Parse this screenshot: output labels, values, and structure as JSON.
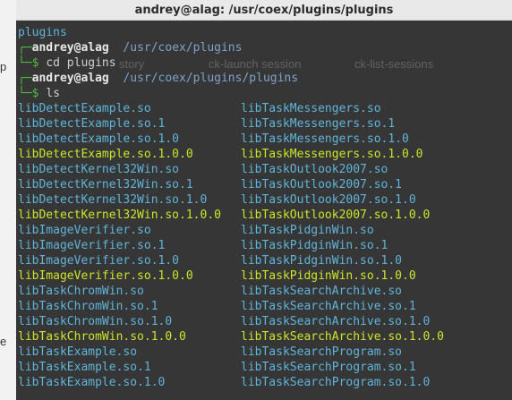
{
  "window": {
    "title": "andrey@alag: /usr/coex/plugins/plugins"
  },
  "background_hints": {
    "left_chars": [
      "p",
      "e"
    ],
    "faint_labels": [
      "ck-launch session",
      "ck-list-sessions",
      "story"
    ]
  },
  "header_line": "plugins",
  "prompts": [
    {
      "user": "andrey@alag",
      "path": "/usr/coex/plugins",
      "command": "cd plugins"
    },
    {
      "user": "andrey@alag",
      "path": "/usr/coex/plugins/plugins",
      "command": "ls"
    }
  ],
  "listing": {
    "left": [
      {
        "name": "libDetectExample.so",
        "kind": "link"
      },
      {
        "name": "libDetectExample.so.1",
        "kind": "link"
      },
      {
        "name": "libDetectExample.so.1.0",
        "kind": "link"
      },
      {
        "name": "libDetectExample.so.1.0.0",
        "kind": "file"
      },
      {
        "name": "libDetectKernel32Win.so",
        "kind": "link"
      },
      {
        "name": "libDetectKernel32Win.so.1",
        "kind": "link"
      },
      {
        "name": "libDetectKernel32Win.so.1.0",
        "kind": "link"
      },
      {
        "name": "libDetectKernel32Win.so.1.0.0",
        "kind": "file"
      },
      {
        "name": "libImageVerifier.so",
        "kind": "link"
      },
      {
        "name": "libImageVerifier.so.1",
        "kind": "link"
      },
      {
        "name": "libImageVerifier.so.1.0",
        "kind": "link"
      },
      {
        "name": "libImageVerifier.so.1.0.0",
        "kind": "file"
      },
      {
        "name": "libTaskChromWin.so",
        "kind": "link"
      },
      {
        "name": "libTaskChromWin.so.1",
        "kind": "link"
      },
      {
        "name": "libTaskChromWin.so.1.0",
        "kind": "link"
      },
      {
        "name": "libTaskChromWin.so.1.0.0",
        "kind": "file"
      },
      {
        "name": "libTaskExample.so",
        "kind": "link"
      },
      {
        "name": "libTaskExample.so.1",
        "kind": "link"
      },
      {
        "name": "libTaskExample.so.1.0",
        "kind": "link"
      }
    ],
    "right": [
      {
        "name": "libTaskMessengers.so",
        "kind": "link"
      },
      {
        "name": "libTaskMessengers.so.1",
        "kind": "link"
      },
      {
        "name": "libTaskMessengers.so.1.0",
        "kind": "link"
      },
      {
        "name": "libTaskMessengers.so.1.0.0",
        "kind": "file"
      },
      {
        "name": "libTaskOutlook2007.so",
        "kind": "link"
      },
      {
        "name": "libTaskOutlook2007.so.1",
        "kind": "link"
      },
      {
        "name": "libTaskOutlook2007.so.1.0",
        "kind": "link"
      },
      {
        "name": "libTaskOutlook2007.so.1.0.0",
        "kind": "file"
      },
      {
        "name": "libTaskPidginWin.so",
        "kind": "link"
      },
      {
        "name": "libTaskPidginWin.so.1",
        "kind": "link"
      },
      {
        "name": "libTaskPidginWin.so.1.0",
        "kind": "link"
      },
      {
        "name": "libTaskPidginWin.so.1.0.0",
        "kind": "file"
      },
      {
        "name": "libTaskSearchArchive.so",
        "kind": "link"
      },
      {
        "name": "libTaskSearchArchive.so.1",
        "kind": "link"
      },
      {
        "name": "libTaskSearchArchive.so.1.0",
        "kind": "link"
      },
      {
        "name": "libTaskSearchArchive.so.1.0.0",
        "kind": "file"
      },
      {
        "name": "libTaskSearchProgram.so",
        "kind": "link"
      },
      {
        "name": "libTaskSearchProgram.so.1",
        "kind": "link"
      },
      {
        "name": "libTaskSearchProgram.so.1.0",
        "kind": "link"
      }
    ]
  },
  "colors": {
    "link": "#5fb4d9",
    "file": "#cde42a",
    "prompt_frame": "#4bbe3e",
    "terminal_bg": "#282828"
  }
}
